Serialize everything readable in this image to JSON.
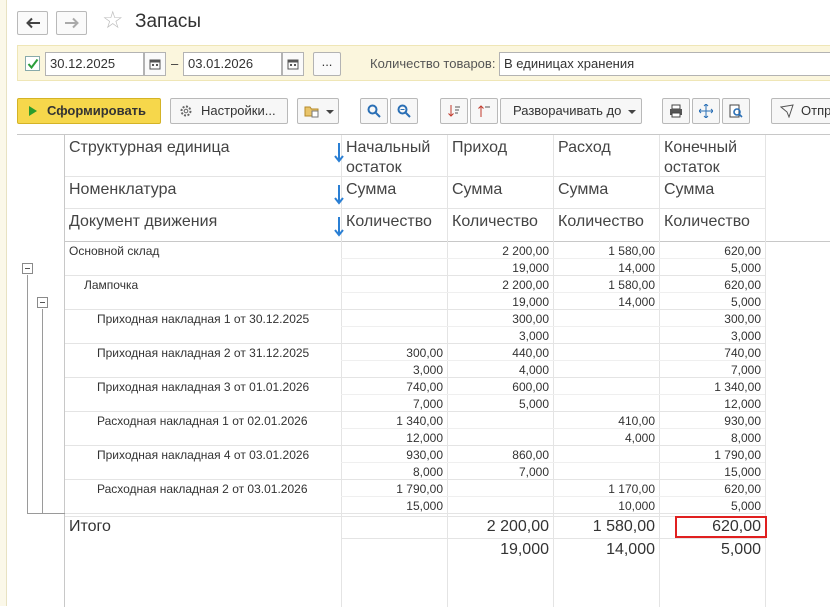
{
  "window": {
    "title": "Запасы"
  },
  "filters": {
    "date_from": "30.12.2025",
    "date_separator": "–",
    "date_to": "03.01.2026",
    "more_label": "...",
    "quantity_label": "Количество товаров:",
    "quantity_value": "В единицах хранения"
  },
  "toolbar": {
    "generate_label": "Сформировать",
    "settings_label": "Настройки...",
    "expand_label": "Разворачивать до",
    "send_label": "Отпр"
  },
  "table": {
    "dim_headers": [
      "Структурная единица",
      "Номенклатура",
      "Документ движения"
    ],
    "columns": [
      {
        "title": [
          "Начальный",
          "остаток"
        ],
        "sum_label": "Сумма",
        "qty_label": "Количество"
      },
      {
        "title": [
          "Приход",
          ""
        ],
        "sum_label": "Сумма",
        "qty_label": "Количество"
      },
      {
        "title": [
          "Расход",
          ""
        ],
        "sum_label": "Сумма",
        "qty_label": "Количество"
      },
      {
        "title": [
          "Конечный",
          "остаток"
        ],
        "sum_label": "Сумма",
        "qty_label": "Количество"
      }
    ],
    "rows": [
      {
        "name": "Основной склад",
        "level": 0,
        "sum": [
          "",
          "2 200,00",
          "1 580,00",
          "620,00"
        ],
        "qty": [
          "",
          "19,000",
          "14,000",
          "5,000"
        ]
      },
      {
        "name": "Лампочка",
        "level": 1,
        "sum": [
          "",
          "2 200,00",
          "1 580,00",
          "620,00"
        ],
        "qty": [
          "",
          "19,000",
          "14,000",
          "5,000"
        ]
      },
      {
        "name": "Приходная накладная 1 от 30.12.2025",
        "level": 2,
        "sum": [
          "",
          "300,00",
          "",
          "300,00"
        ],
        "qty": [
          "",
          "3,000",
          "",
          "3,000"
        ]
      },
      {
        "name": "Приходная накладная 2 от 31.12.2025",
        "level": 2,
        "sum": [
          "300,00",
          "440,00",
          "",
          "740,00"
        ],
        "qty": [
          "3,000",
          "4,000",
          "",
          "7,000"
        ]
      },
      {
        "name": "Приходная накладная 3 от 01.01.2026",
        "level": 2,
        "sum": [
          "740,00",
          "600,00",
          "",
          "1 340,00"
        ],
        "qty": [
          "7,000",
          "5,000",
          "",
          "12,000"
        ]
      },
      {
        "name": "Расходная накладная 1 от 02.01.2026",
        "level": 2,
        "sum": [
          "1 340,00",
          "",
          "410,00",
          "930,00"
        ],
        "qty": [
          "12,000",
          "",
          "4,000",
          "8,000"
        ]
      },
      {
        "name": "Приходная накладная 4 от 03.01.2026",
        "level": 2,
        "sum": [
          "930,00",
          "860,00",
          "",
          "1 790,00"
        ],
        "qty": [
          "8,000",
          "7,000",
          "",
          "15,000"
        ]
      },
      {
        "name": "Расходная накладная 2 от 03.01.2026",
        "level": 2,
        "sum": [
          "1 790,00",
          "",
          "1 170,00",
          "620,00"
        ],
        "qty": [
          "15,000",
          "",
          "10,000",
          "5,000"
        ]
      }
    ],
    "total": {
      "label": "Итого",
      "sum": [
        "",
        "2 200,00",
        "1 580,00",
        "620,00"
      ],
      "qty": [
        "",
        "19,000",
        "14,000",
        "5,000"
      ]
    }
  },
  "colors": {
    "accent_button": "#f6d74b",
    "highlight": "#e02020",
    "arrow": "#2a7fd4"
  }
}
